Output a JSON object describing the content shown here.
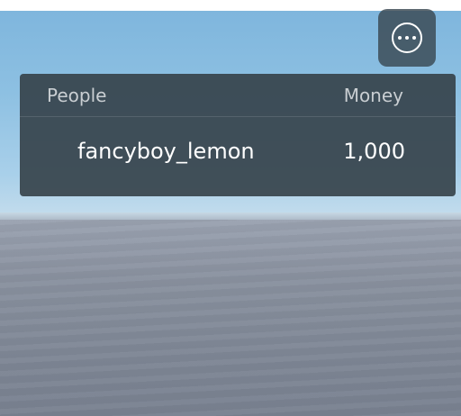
{
  "menu": {
    "icon": "more-options-icon"
  },
  "leaderboard": {
    "headers": {
      "people": "People",
      "money": "Money"
    },
    "rows": [
      {
        "name": "fancyboy_lemon",
        "money": "1,000"
      }
    ]
  },
  "colors": {
    "panel": "#344048",
    "sky": "#8dc0e2",
    "ground": "#858d9b",
    "text": "#ffffff",
    "header_text": "#c9ced2"
  }
}
